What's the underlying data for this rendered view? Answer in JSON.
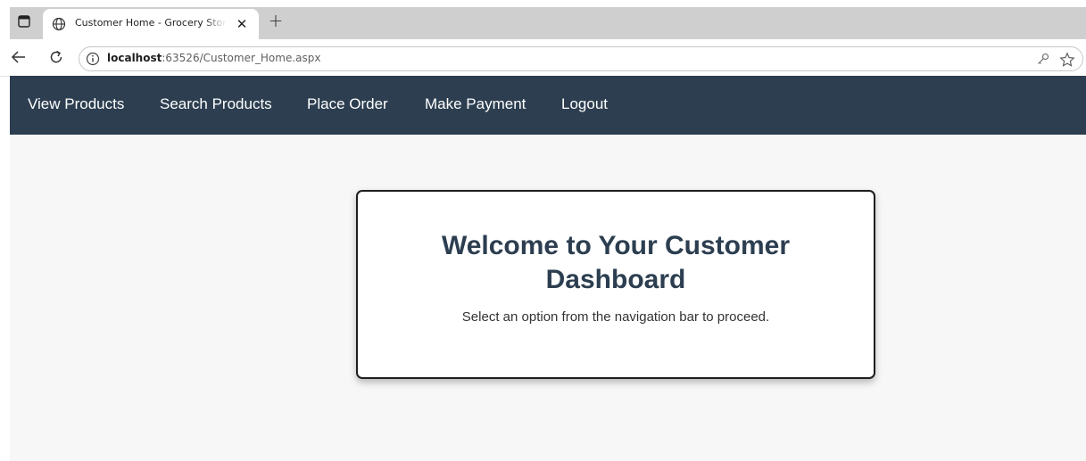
{
  "browser": {
    "tab_title": "Customer Home - Grocery Store M",
    "tab_close": "✕",
    "new_tab": "+",
    "url_host": "localhost",
    "url_rest": ":63526/Customer_Home.aspx"
  },
  "nav": {
    "items": [
      "View Products",
      "Search Products",
      "Place Order",
      "Make Payment",
      "Logout"
    ]
  },
  "card": {
    "heading_line1": "Welcome to Your Customer",
    "heading_line2": "Dashboard",
    "subtitle": "Select an option from the navigation bar to proceed."
  },
  "colors": {
    "navbar": "#2c3e50",
    "heading": "#2c3e50",
    "page_bg": "#f7f7f7"
  }
}
